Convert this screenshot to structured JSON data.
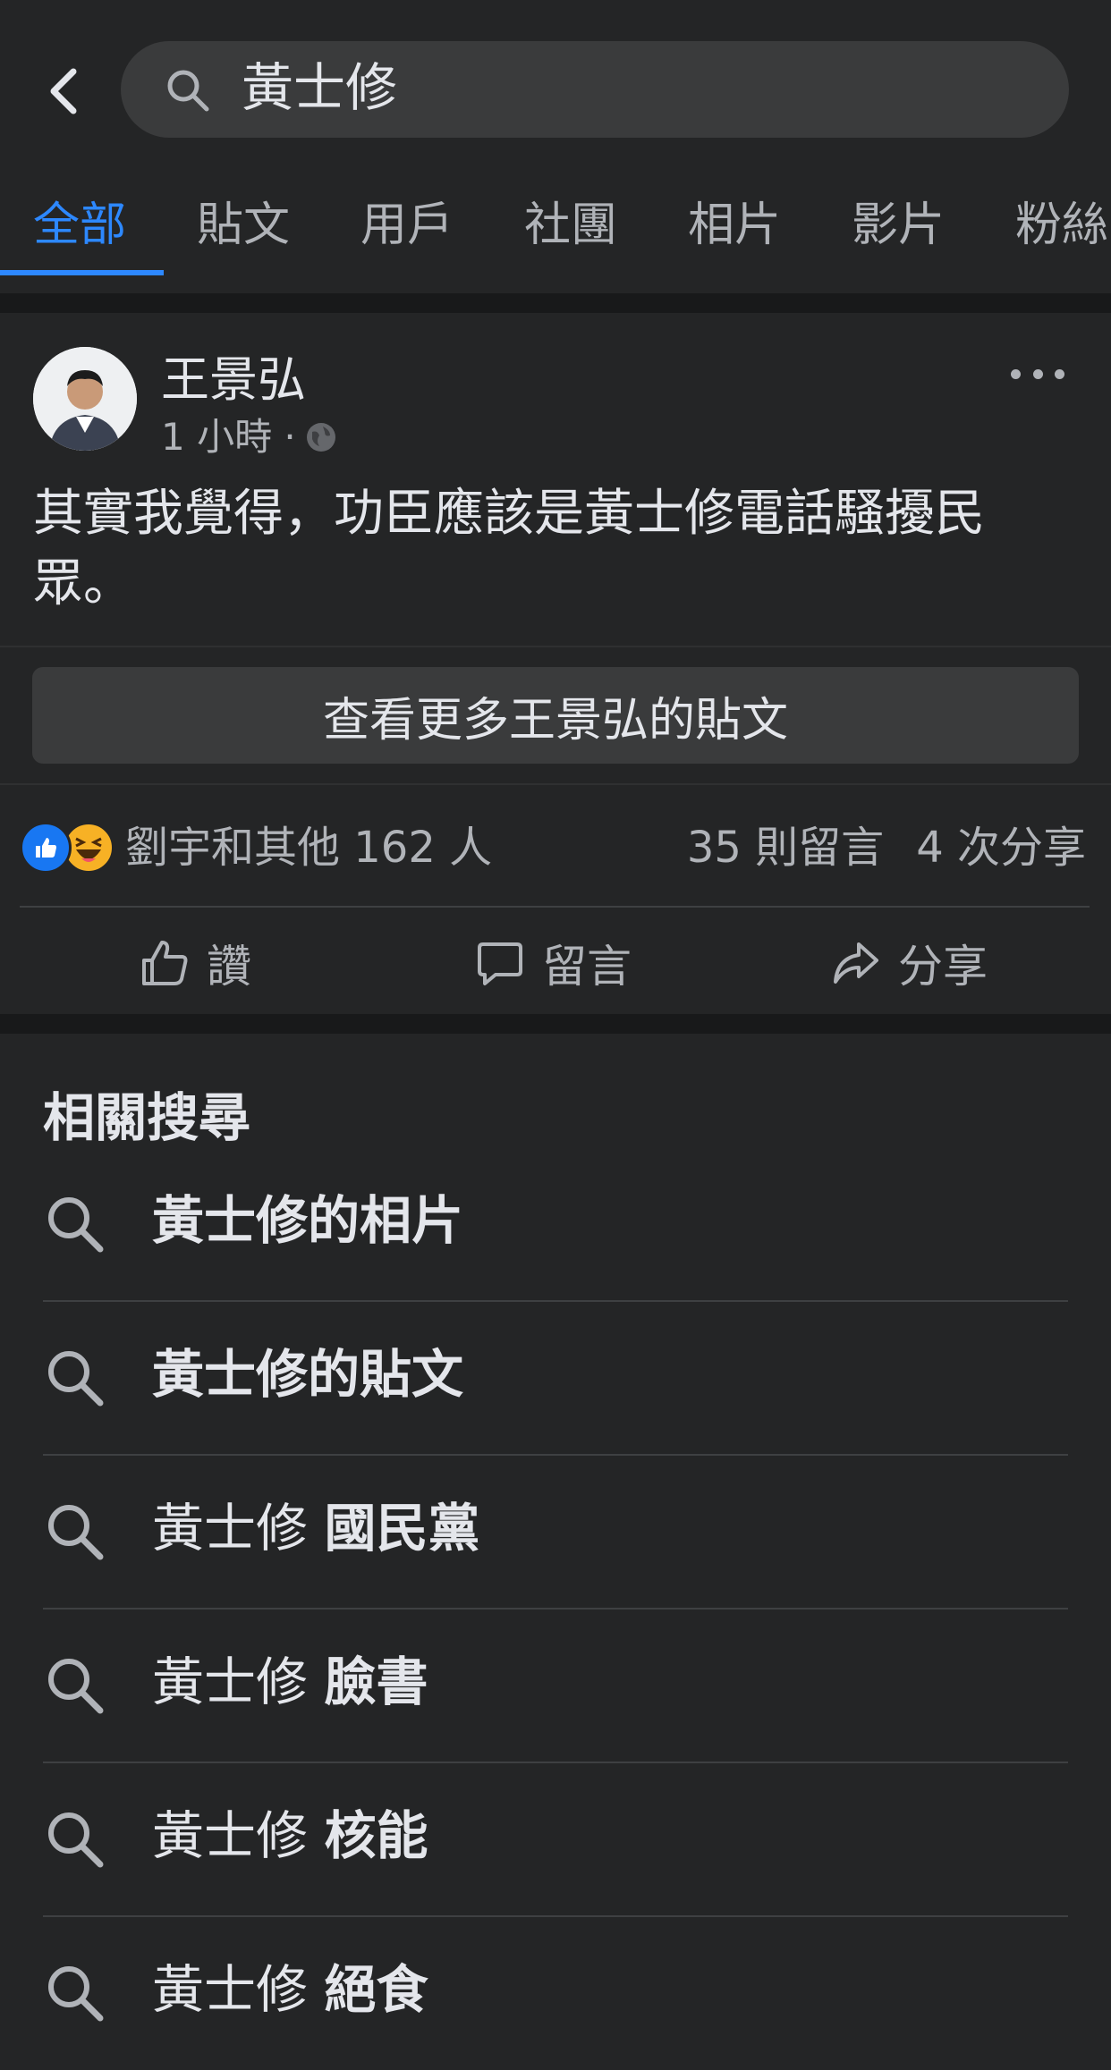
{
  "search": {
    "query": "黃士修"
  },
  "tabs": [
    {
      "label": "全部",
      "active": true
    },
    {
      "label": "貼文"
    },
    {
      "label": "用戶"
    },
    {
      "label": "社團"
    },
    {
      "label": "相片"
    },
    {
      "label": "影片"
    },
    {
      "label": "粉絲"
    }
  ],
  "post": {
    "author": "王景弘",
    "time": "1 小時 ·",
    "text": "其實我覺得，功臣應該是黃士修電話騷擾民眾。",
    "see_more": "查看更多王景弘的貼文",
    "reactions_text": "劉宇和其他 162 人",
    "comments": "35 則留言",
    "shares": "4 次分享",
    "actions": {
      "like": "讚",
      "comment": "留言",
      "share": "分享"
    }
  },
  "related": {
    "title": "相關搜尋",
    "items": [
      {
        "prefix": "",
        "bold": "黃士修的相片"
      },
      {
        "prefix": "",
        "bold": "黃士修的貼文"
      },
      {
        "prefix": "黃士修 ",
        "bold": "國民黨"
      },
      {
        "prefix": "黃士修 ",
        "bold": "臉書"
      },
      {
        "prefix": "黃士修 ",
        "bold": "核能"
      },
      {
        "prefix": "黃士修 ",
        "bold": "絕食"
      }
    ]
  },
  "colors": {
    "accent": "#2d88ff",
    "background": "#242526",
    "surface": "#3a3b3c"
  }
}
